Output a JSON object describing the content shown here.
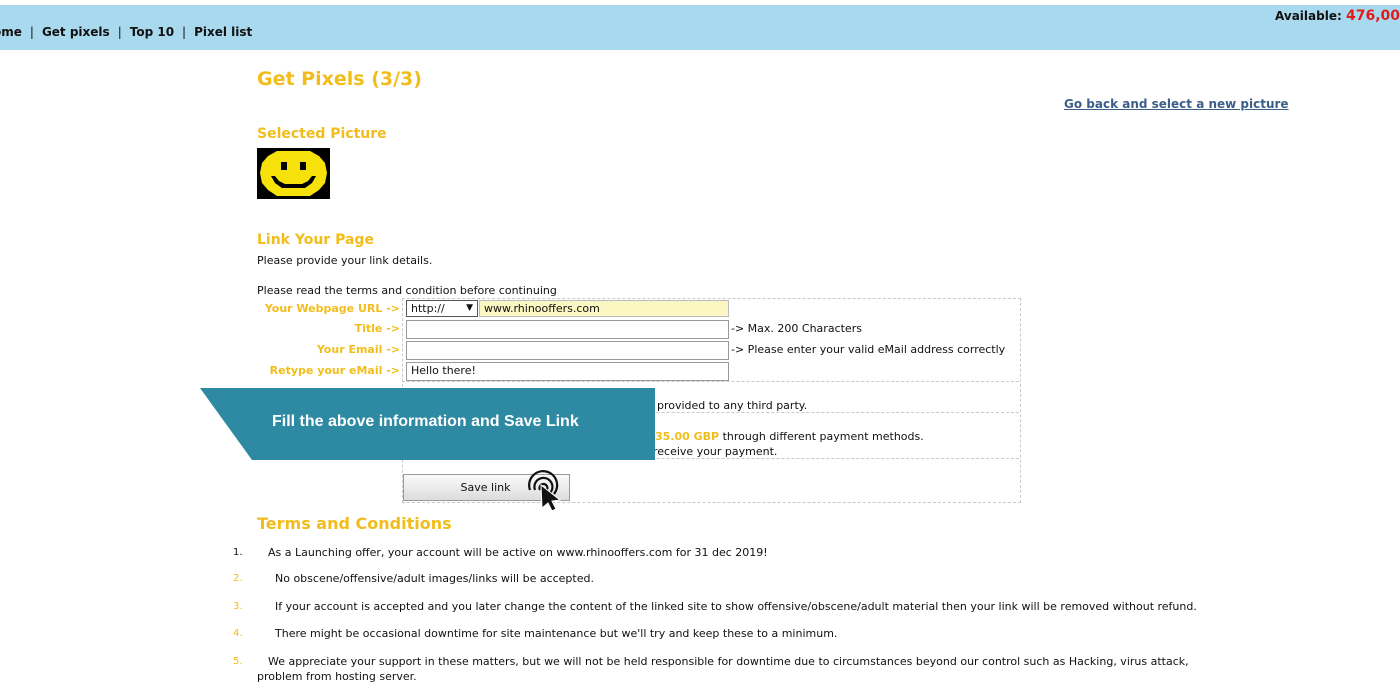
{
  "nav": {
    "items": [
      "ome",
      "Get pixels",
      "Top 10",
      "Pixel list"
    ],
    "available_label": "Available:",
    "available_value": "476,00"
  },
  "page": {
    "title": "Get Pixels (3/3)",
    "go_back": "Go back and select a new picture",
    "selected_picture_heading": "Selected Picture",
    "link_heading": "Link Your Page",
    "link_intro": "Please provide your link details.",
    "terms_read": "Please read the terms and condition before continuing"
  },
  "form": {
    "url_label": "Your Webpage URL ->",
    "protocol_selected": "http://",
    "url_value": "www.rhinooffers.com",
    "title_label": "Title ->",
    "title_value": "",
    "title_hint": "-> Max. 200 Characters",
    "email_label": "Your Email ->",
    "email_value": "",
    "email_hint": "-> Please enter your valid eMail address correctly",
    "retype_label": "Retype your eMail ->",
    "retype_value": "Hello there!",
    "privacy_text": "provided to any third party.",
    "price": "35.00 GBP",
    "price_text": "through different payment methods.",
    "payment_text": "receive your payment.",
    "save_label": "Save link"
  },
  "callout": {
    "text": "Fill the above information and Save Link"
  },
  "terms": {
    "heading": "Terms and Conditions",
    "items": [
      {
        "num": "1.",
        "text": "As a Launching offer, your account will be active on www.rhinooffers.com for 31 dec 2019!"
      },
      {
        "num": "2.",
        "text": "No obscene/offensive/adult images/links will be accepted."
      },
      {
        "num": "3.",
        "text": "If your account is accepted and you later change the content of the linked site to show offensive/obscene/adult material then your link will be removed without refund."
      },
      {
        "num": "4.",
        "text": "There might be occasional downtime for site maintenance but we'll try and keep these to a minimum."
      },
      {
        "num": "5.",
        "text": "We appreciate your support in these matters, but we will not be held responsible for downtime due to circumstances beyond our control such as Hacking, virus attack,"
      },
      {
        "num": "",
        "text": "problem from hosting server."
      }
    ]
  },
  "colors": {
    "topbar": "#a9d9ee",
    "accent_yellow": "#f2bd1b",
    "callout": "#2e8aa3",
    "available_red": "#e21b1b"
  }
}
